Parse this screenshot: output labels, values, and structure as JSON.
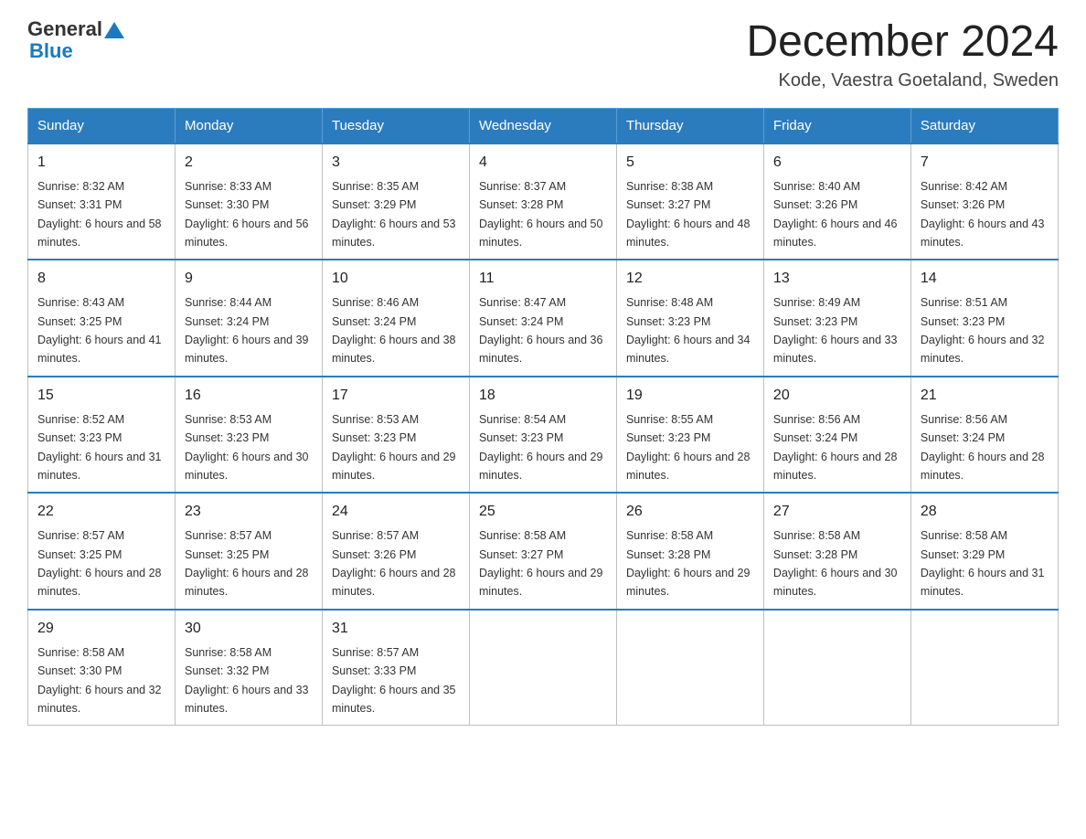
{
  "header": {
    "logo_general": "General",
    "logo_blue": "Blue",
    "month_title": "December 2024",
    "location": "Kode, Vaestra Goetaland, Sweden"
  },
  "columns": [
    "Sunday",
    "Monday",
    "Tuesday",
    "Wednesday",
    "Thursday",
    "Friday",
    "Saturday"
  ],
  "weeks": [
    [
      {
        "day": "1",
        "sunrise": "8:32 AM",
        "sunset": "3:31 PM",
        "daylight": "6 hours and 58 minutes."
      },
      {
        "day": "2",
        "sunrise": "8:33 AM",
        "sunset": "3:30 PM",
        "daylight": "6 hours and 56 minutes."
      },
      {
        "day": "3",
        "sunrise": "8:35 AM",
        "sunset": "3:29 PM",
        "daylight": "6 hours and 53 minutes."
      },
      {
        "day": "4",
        "sunrise": "8:37 AM",
        "sunset": "3:28 PM",
        "daylight": "6 hours and 50 minutes."
      },
      {
        "day": "5",
        "sunrise": "8:38 AM",
        "sunset": "3:27 PM",
        "daylight": "6 hours and 48 minutes."
      },
      {
        "day": "6",
        "sunrise": "8:40 AM",
        "sunset": "3:26 PM",
        "daylight": "6 hours and 46 minutes."
      },
      {
        "day": "7",
        "sunrise": "8:42 AM",
        "sunset": "3:26 PM",
        "daylight": "6 hours and 43 minutes."
      }
    ],
    [
      {
        "day": "8",
        "sunrise": "8:43 AM",
        "sunset": "3:25 PM",
        "daylight": "6 hours and 41 minutes."
      },
      {
        "day": "9",
        "sunrise": "8:44 AM",
        "sunset": "3:24 PM",
        "daylight": "6 hours and 39 minutes."
      },
      {
        "day": "10",
        "sunrise": "8:46 AM",
        "sunset": "3:24 PM",
        "daylight": "6 hours and 38 minutes."
      },
      {
        "day": "11",
        "sunrise": "8:47 AM",
        "sunset": "3:24 PM",
        "daylight": "6 hours and 36 minutes."
      },
      {
        "day": "12",
        "sunrise": "8:48 AM",
        "sunset": "3:23 PM",
        "daylight": "6 hours and 34 minutes."
      },
      {
        "day": "13",
        "sunrise": "8:49 AM",
        "sunset": "3:23 PM",
        "daylight": "6 hours and 33 minutes."
      },
      {
        "day": "14",
        "sunrise": "8:51 AM",
        "sunset": "3:23 PM",
        "daylight": "6 hours and 32 minutes."
      }
    ],
    [
      {
        "day": "15",
        "sunrise": "8:52 AM",
        "sunset": "3:23 PM",
        "daylight": "6 hours and 31 minutes."
      },
      {
        "day": "16",
        "sunrise": "8:53 AM",
        "sunset": "3:23 PM",
        "daylight": "6 hours and 30 minutes."
      },
      {
        "day": "17",
        "sunrise": "8:53 AM",
        "sunset": "3:23 PM",
        "daylight": "6 hours and 29 minutes."
      },
      {
        "day": "18",
        "sunrise": "8:54 AM",
        "sunset": "3:23 PM",
        "daylight": "6 hours and 29 minutes."
      },
      {
        "day": "19",
        "sunrise": "8:55 AM",
        "sunset": "3:23 PM",
        "daylight": "6 hours and 28 minutes."
      },
      {
        "day": "20",
        "sunrise": "8:56 AM",
        "sunset": "3:24 PM",
        "daylight": "6 hours and 28 minutes."
      },
      {
        "day": "21",
        "sunrise": "8:56 AM",
        "sunset": "3:24 PM",
        "daylight": "6 hours and 28 minutes."
      }
    ],
    [
      {
        "day": "22",
        "sunrise": "8:57 AM",
        "sunset": "3:25 PM",
        "daylight": "6 hours and 28 minutes."
      },
      {
        "day": "23",
        "sunrise": "8:57 AM",
        "sunset": "3:25 PM",
        "daylight": "6 hours and 28 minutes."
      },
      {
        "day": "24",
        "sunrise": "8:57 AM",
        "sunset": "3:26 PM",
        "daylight": "6 hours and 28 minutes."
      },
      {
        "day": "25",
        "sunrise": "8:58 AM",
        "sunset": "3:27 PM",
        "daylight": "6 hours and 29 minutes."
      },
      {
        "day": "26",
        "sunrise": "8:58 AM",
        "sunset": "3:28 PM",
        "daylight": "6 hours and 29 minutes."
      },
      {
        "day": "27",
        "sunrise": "8:58 AM",
        "sunset": "3:28 PM",
        "daylight": "6 hours and 30 minutes."
      },
      {
        "day": "28",
        "sunrise": "8:58 AM",
        "sunset": "3:29 PM",
        "daylight": "6 hours and 31 minutes."
      }
    ],
    [
      {
        "day": "29",
        "sunrise": "8:58 AM",
        "sunset": "3:30 PM",
        "daylight": "6 hours and 32 minutes."
      },
      {
        "day": "30",
        "sunrise": "8:58 AM",
        "sunset": "3:32 PM",
        "daylight": "6 hours and 33 minutes."
      },
      {
        "day": "31",
        "sunrise": "8:57 AM",
        "sunset": "3:33 PM",
        "daylight": "6 hours and 35 minutes."
      },
      null,
      null,
      null,
      null
    ]
  ]
}
